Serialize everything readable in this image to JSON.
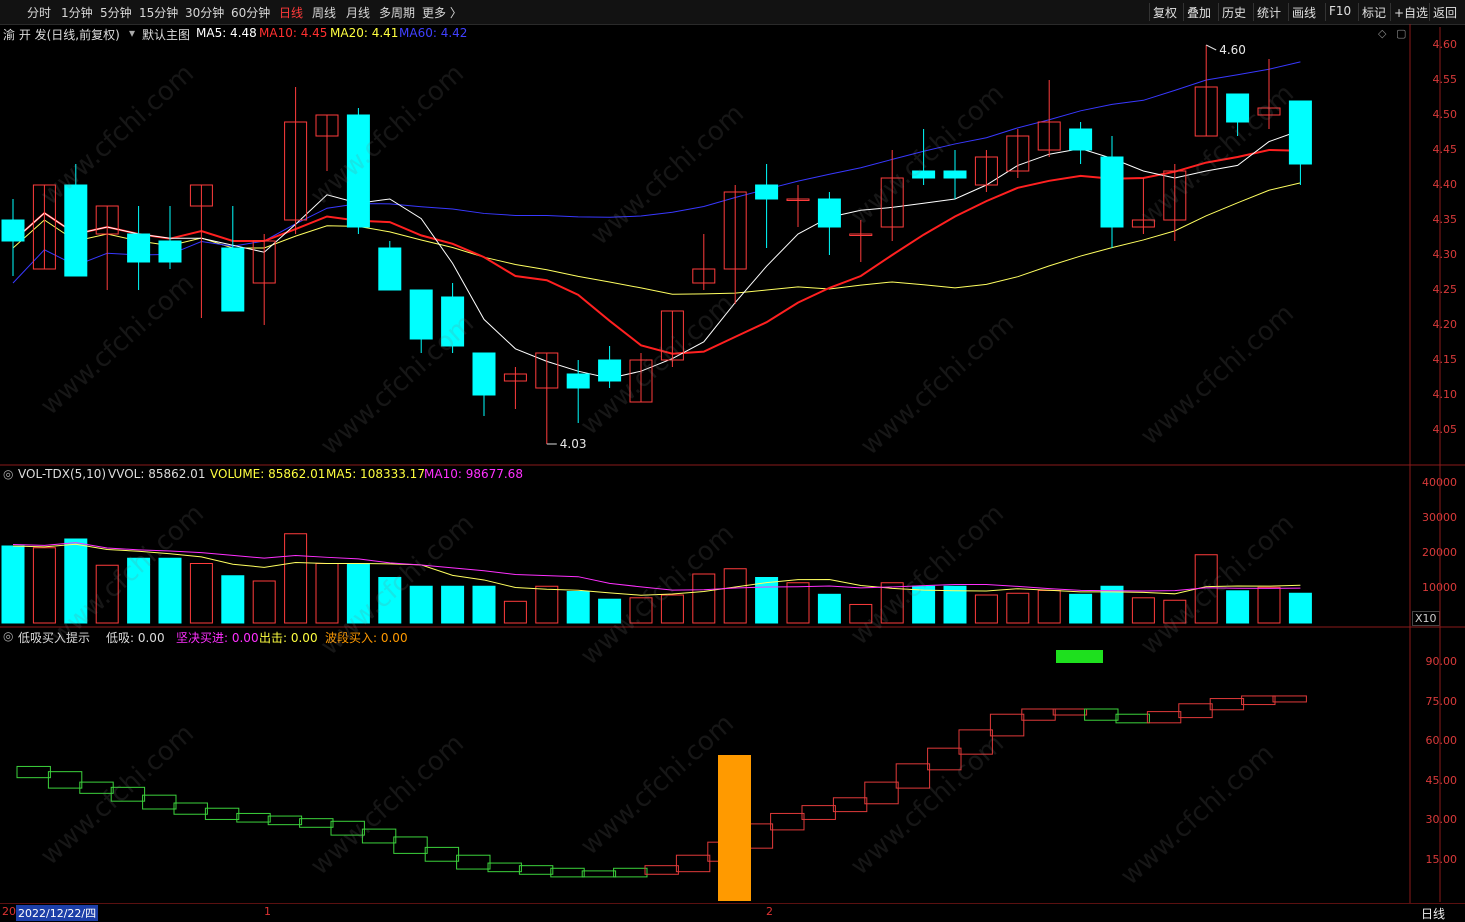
{
  "toolbar": {
    "periods": [
      "分时",
      "1分钟",
      "5分钟",
      "15分钟",
      "30分钟",
      "60分钟",
      "日线",
      "周线",
      "月线",
      "多周期",
      "更多 〉"
    ],
    "active_period": "日线",
    "right_buttons": [
      "复权",
      "叠加",
      "历史",
      "统计",
      "画线",
      "F10",
      "标记",
      "+自选",
      "返回"
    ]
  },
  "main_panel": {
    "title": "渝 开 发(日线,前复权)",
    "template": "默认主图",
    "ma5_label": "MA5: 4.48",
    "ma10_label": "MA10: 4.45",
    "ma20_label": "MA20: 4.41",
    "ma60_label": "MA60: 4.42",
    "high_marker": "4.60",
    "low_marker": "4.03",
    "axis": [
      "4.60",
      "4.55",
      "4.50",
      "4.45",
      "4.40",
      "4.35",
      "4.30",
      "4.25",
      "4.20",
      "4.15",
      "4.10",
      "4.05"
    ]
  },
  "vol_panel": {
    "title": "VOL-TDX(5,10)",
    "vvol_label": "VVOL: 85862.01",
    "volume_label": "VOLUME: 85862.01",
    "ma5_label": "MA5: 108333.17",
    "ma10_label": "MA10: 98677.68",
    "axis": [
      "40000",
      "30000",
      "20000",
      "10000"
    ],
    "unit": "X10"
  },
  "ind_panel": {
    "title": "低吸买入提示",
    "dixi_label": "低吸: 0.00",
    "jianjue_label": "坚决买进: 0.00",
    "chuji_label": "出击: 0.00",
    "boduan_label": "波段买入: 0.00",
    "axis": [
      "90.00",
      "75.00",
      "60.00",
      "45.00",
      "30.00",
      "15.00"
    ]
  },
  "bottom": {
    "date": "2022/12/22/四",
    "year_prefix": "20",
    "marker_1": "1",
    "marker_2": "2",
    "period": "日线"
  },
  "watermark": "www.cfchi.com",
  "colors": {
    "up": "#ff3c3c",
    "down": "#00ffff",
    "ma5": "#ffffff",
    "ma10": "#ff2020",
    "ma20": "#ffff60",
    "ma60": "#3838ff",
    "vma10": "#ff30ff",
    "ind_green": "#3cd23c",
    "ind_red": "#e03a3a",
    "orange": "#ff9a00"
  },
  "chart_data": {
    "type": "candlestick",
    "candles": [
      {
        "o": 4.35,
        "h": 4.38,
        "l": 4.27,
        "c": 4.32
      },
      {
        "o": 4.28,
        "h": 4.4,
        "l": 4.28,
        "c": 4.4
      },
      {
        "o": 4.4,
        "h": 4.43,
        "l": 4.27,
        "c": 4.27
      },
      {
        "o": 4.33,
        "h": 4.36,
        "l": 4.25,
        "c": 4.37
      },
      {
        "o": 4.33,
        "h": 4.37,
        "l": 4.25,
        "c": 4.29
      },
      {
        "o": 4.32,
        "h": 4.37,
        "l": 4.28,
        "c": 4.29
      },
      {
        "o": 4.37,
        "h": 4.36,
        "l": 4.21,
        "c": 4.4
      },
      {
        "o": 4.31,
        "h": 4.37,
        "l": 4.25,
        "c": 4.22
      },
      {
        "o": 4.26,
        "h": 4.33,
        "l": 4.2,
        "c": 4.32
      },
      {
        "o": 4.35,
        "h": 4.54,
        "l": 4.33,
        "c": 4.49
      },
      {
        "o": 4.47,
        "h": 4.5,
        "l": 4.42,
        "c": 4.5
      },
      {
        "o": 4.5,
        "h": 4.51,
        "l": 4.33,
        "c": 4.34
      },
      {
        "o": 4.31,
        "h": 4.32,
        "l": 4.25,
        "c": 4.25
      },
      {
        "o": 4.25,
        "h": 4.23,
        "l": 4.16,
        "c": 4.18
      },
      {
        "o": 4.24,
        "h": 4.26,
        "l": 4.16,
        "c": 4.17
      },
      {
        "o": 4.16,
        "h": 4.16,
        "l": 4.07,
        "c": 4.1
      },
      {
        "o": 4.12,
        "h": 4.14,
        "l": 4.08,
        "c": 4.13
      },
      {
        "o": 4.11,
        "h": 4.16,
        "l": 4.03,
        "c": 4.16
      },
      {
        "o": 4.13,
        "h": 4.15,
        "l": 4.06,
        "c": 4.11
      },
      {
        "o": 4.15,
        "h": 4.17,
        "l": 4.11,
        "c": 4.12
      },
      {
        "o": 4.09,
        "h": 4.16,
        "l": 4.09,
        "c": 4.15
      },
      {
        "o": 4.15,
        "h": 4.22,
        "l": 4.14,
        "c": 4.22
      },
      {
        "o": 4.26,
        "h": 4.33,
        "l": 4.25,
        "c": 4.28
      },
      {
        "o": 4.28,
        "h": 4.4,
        "l": 4.23,
        "c": 4.39
      },
      {
        "o": 4.4,
        "h": 4.43,
        "l": 4.31,
        "c": 4.38
      },
      {
        "o": 4.38,
        "h": 4.4,
        "l": 4.34,
        "c": 4.38
      },
      {
        "o": 4.38,
        "h": 4.39,
        "l": 4.3,
        "c": 4.34
      },
      {
        "o": 4.33,
        "h": 4.35,
        "l": 4.29,
        "c": 4.33
      },
      {
        "o": 4.34,
        "h": 4.45,
        "l": 4.32,
        "c": 4.41
      },
      {
        "o": 4.42,
        "h": 4.48,
        "l": 4.4,
        "c": 4.41
      },
      {
        "o": 4.42,
        "h": 4.45,
        "l": 4.38,
        "c": 4.41
      },
      {
        "o": 4.4,
        "h": 4.45,
        "l": 4.39,
        "c": 4.44
      },
      {
        "o": 4.42,
        "h": 4.48,
        "l": 4.41,
        "c": 4.47
      },
      {
        "o": 4.45,
        "h": 4.55,
        "l": 4.44,
        "c": 4.49
      },
      {
        "o": 4.48,
        "h": 4.49,
        "l": 4.43,
        "c": 4.45
      },
      {
        "o": 4.44,
        "h": 4.47,
        "l": 4.31,
        "c": 4.34
      },
      {
        "o": 4.34,
        "h": 4.41,
        "l": 4.33,
        "c": 4.35
      },
      {
        "o": 4.35,
        "h": 4.43,
        "l": 4.32,
        "c": 4.42
      },
      {
        "o": 4.47,
        "h": 4.6,
        "l": 4.47,
        "c": 4.54
      },
      {
        "o": 4.53,
        "h": 4.53,
        "l": 4.47,
        "c": 4.49
      },
      {
        "o": 4.5,
        "h": 4.58,
        "l": 4.48,
        "c": 4.51
      },
      {
        "o": 4.52,
        "h": 4.52,
        "l": 4.4,
        "c": 4.43
      }
    ],
    "volume": [
      22,
      21.5,
      24,
      16.5,
      18.5,
      18.5,
      17,
      13.5,
      12,
      25.5,
      17,
      17,
      13,
      10.5,
      10.5,
      10.5,
      6.2,
      10.5,
      9,
      6.8,
      7.2,
      8,
      14,
      15.5,
      13,
      11.5,
      8.2,
      5.3,
      11.5,
      10.5,
      10.5,
      8,
      8.5,
      9.3,
      8.2,
      10.5,
      7.2,
      6.5,
      19.5,
      9.2,
      10.2,
      8.5
    ],
    "indicator_level": [
      50,
      48,
      44,
      42,
      39,
      36,
      34,
      32,
      31,
      30,
      29,
      26,
      23,
      19,
      16,
      13,
      12,
      11,
      10,
      10,
      11,
      12,
      16,
      21,
      28,
      32,
      35,
      38,
      44,
      51,
      57,
      64,
      70,
      72,
      72,
      70,
      69,
      71,
      74,
      76,
      77,
      77
    ]
  }
}
